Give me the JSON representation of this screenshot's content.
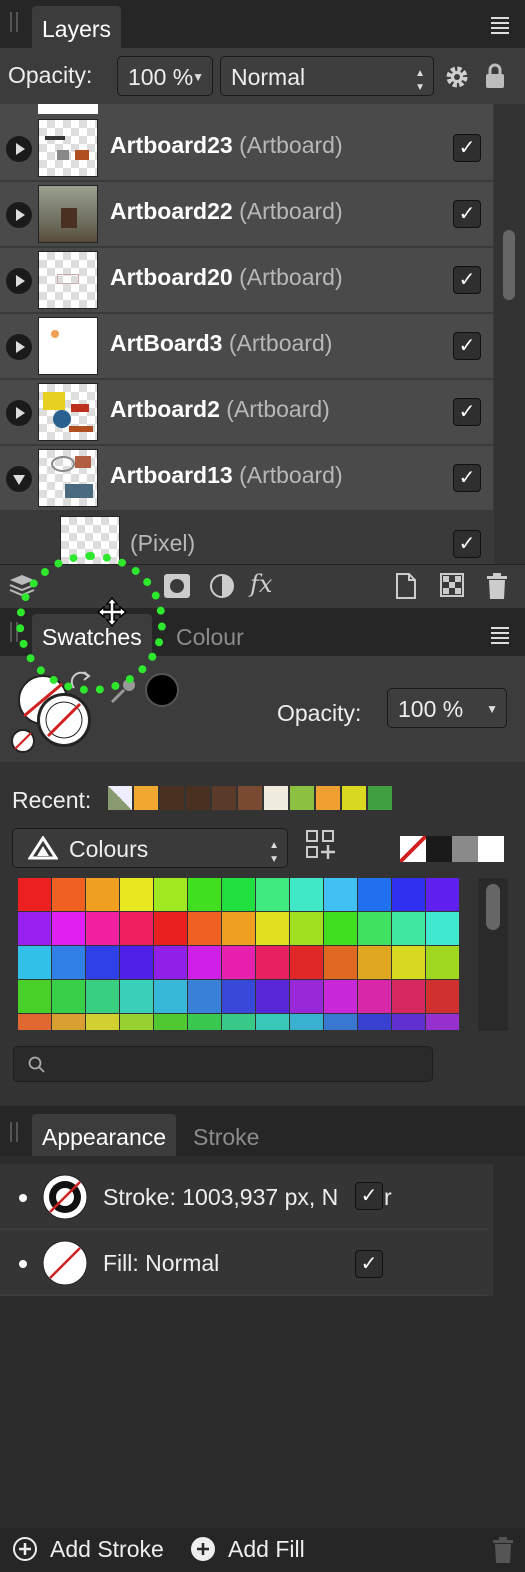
{
  "layers_panel": {
    "tab_label": "Layers",
    "opacity_label": "Opacity:",
    "opacity_value": "100 %",
    "blend_mode": "Normal",
    "rows": [
      {
        "name": "Artboard23",
        "type": "(Artboard)"
      },
      {
        "name": "Artboard22",
        "type": "(Artboard)"
      },
      {
        "name": "Artboard20",
        "type": "(Artboard)"
      },
      {
        "name": "ArtBoard3",
        "type": "(Artboard)"
      },
      {
        "name": "Artboard2",
        "type": "(Artboard)"
      },
      {
        "name": "Artboard13",
        "type": "(Artboard)"
      }
    ],
    "child_row": {
      "type": "(Pixel)"
    },
    "footer_fx": "fx"
  },
  "swatches_panel": {
    "tabs": [
      "Swatches",
      "Colour"
    ],
    "opacity_label": "Opacity:",
    "opacity_value": "100 %",
    "recent_label": "Recent:",
    "recent_colors": [
      "#f0a830",
      "#4a3020",
      "#4a3020",
      "#5a3a28",
      "#7a4a30",
      "#f0ece0",
      "#8cc040",
      "#f0a030",
      "#d8d820",
      "#40a040"
    ],
    "palette_name": "Colours",
    "grid_colors": [
      [
        "#ec2020",
        "#f06020",
        "#f0a020",
        "#e8e820",
        "#a0e820",
        "#40e020",
        "#20e040",
        "#40e880",
        "#40e8c8",
        "#40c0f0",
        "#2070f0",
        "#3030f0",
        "#6020f0"
      ],
      [
        "#9820f0",
        "#e020f0",
        "#f020a0",
        "#f02060",
        "#e82020",
        "#f06020",
        "#f0a020",
        "#e0e020",
        "#a0e020",
        "#40e020",
        "#40e060",
        "#40e8a0",
        "#40e8d0"
      ],
      [
        "#30c0e8",
        "#3080e8",
        "#3040e8",
        "#5020e8",
        "#9020e8",
        "#d020e8",
        "#e820b0",
        "#e82060",
        "#e02828",
        "#e06820",
        "#e0a820",
        "#d8d820",
        "#a0d820"
      ],
      [
        "#48d028",
        "#38d048",
        "#38d080",
        "#38d0b8",
        "#38b8d8",
        "#3880d8",
        "#3848d8",
        "#5828d8",
        "#9828d8",
        "#c828d8",
        "#d828a8",
        "#d82860",
        "#d03030"
      ],
      [
        "#e06830",
        "#d8a030",
        "#d0d030",
        "#98d030",
        "#50c830",
        "#38c850",
        "#38c888",
        "#38c8b8",
        "#38b0d0",
        "#3878d0",
        "#3840d0",
        "#6030d0",
        "#9830d0"
      ]
    ],
    "grid_rows_drawn": [
      33,
      33,
      33,
      33,
      16
    ],
    "bw_swatches": [
      "none",
      "#1a1a1a",
      "#8a8a8a",
      "#ffffff"
    ],
    "search_placeholder": ""
  },
  "appearance_panel": {
    "tabs": [
      "Appearance",
      "Stroke"
    ],
    "rows": [
      {
        "label": "Stroke: 1003,937 px, N",
        "suffix": "r"
      },
      {
        "label": "Fill: Normal"
      }
    ],
    "add_stroke_label": "Add Stroke",
    "add_fill_label": "Add Fill"
  }
}
